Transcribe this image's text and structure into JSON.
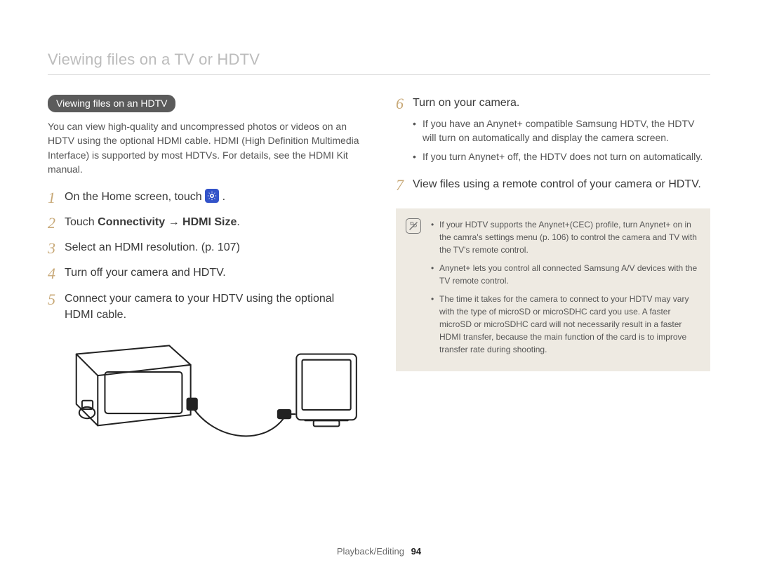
{
  "header": {
    "title": "Viewing files on a TV or HDTV"
  },
  "left": {
    "section_pill": "Viewing files on an HDTV",
    "intro": "You can view high-quality and uncompressed photos or videos on an HDTV using the optional HDMI cable. HDMI (High Definition Multimedia Interface) is supported by most HDTVs. For details, see the HDMI Kit manual.",
    "steps": [
      {
        "num": "1",
        "text_before": "On the Home screen, touch ",
        "text_after": "."
      },
      {
        "num": "2",
        "text_before": "Touch ",
        "bold1": "Connectivity",
        "arrow": " → ",
        "bold2": "HDMI Size",
        "text_after": "."
      },
      {
        "num": "3",
        "text": "Select an HDMI resolution. (p. 107)"
      },
      {
        "num": "4",
        "text": "Turn off your camera and HDTV."
      },
      {
        "num": "5",
        "text": "Connect your camera to your HDTV using the optional HDMI cable."
      }
    ]
  },
  "right": {
    "steps": [
      {
        "num": "6",
        "text": "Turn on your camera.",
        "bullets": [
          "If you have an Anynet+ compatible Samsung HDTV, the HDTV will turn on automatically and display the camera screen.",
          "If you turn Anynet+ off, the HDTV does not turn on automatically."
        ]
      },
      {
        "num": "7",
        "text": "View files using a remote control of your camera or HDTV."
      }
    ],
    "note_bullets": [
      "If your HDTV supports the Anynet+(CEC) profile, turn Anynet+ on in the camra's settings menu (p. 106) to control the camera and TV with the TV's remote control.",
      "Anynet+ lets you control all connected Samsung A/V devices with the TV remote control.",
      "The time it takes for the camera to connect to your HDTV may vary with the type of microSD or microSDHC card you use. A faster microSD or microSDHC card will not necessarily result in a faster HDMI transfer, because the main function of the card is to improve transfer rate during shooting."
    ]
  },
  "footer": {
    "section": "Playback/Editing",
    "page": "94"
  }
}
